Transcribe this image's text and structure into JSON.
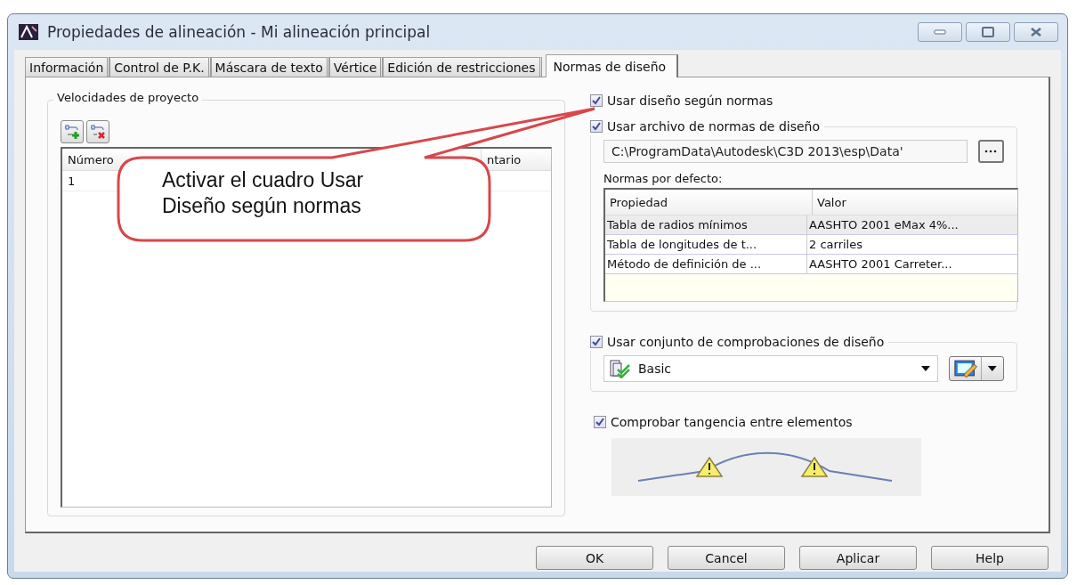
{
  "window": {
    "title": "Propiedades de alineación - Mi alineación principal"
  },
  "tabs": [
    {
      "label": "Información",
      "selected": false
    },
    {
      "label": "Control de P.K.",
      "selected": false
    },
    {
      "label": "Máscara de texto",
      "selected": false
    },
    {
      "label": "Vértice",
      "selected": false
    },
    {
      "label": "Edición de restricciones",
      "selected": false
    },
    {
      "label": "Normas de diseño",
      "selected": true
    }
  ],
  "speeds": {
    "title": "Velocidades de proyecto",
    "columns": [
      "Número",
      "ntario"
    ],
    "rows": [
      [
        "1"
      ]
    ]
  },
  "callout": {
    "text": "Activar el cuadro Usar Diseño según normas"
  },
  "use_design_criteria": {
    "label": "Usar diseño según normas",
    "checked": true
  },
  "criteria_file": {
    "label": "Usar archivo de normas de diseño",
    "checked": true,
    "path": "C:\\ProgramData\\Autodesk\\C3D 2013\\esp\\Data'",
    "defaults_label": "Normas por defecto:",
    "columns": [
      "Propiedad",
      "Valor"
    ],
    "rows": [
      {
        "property": "Tabla de radios mínimos",
        "value": "AASHTO 2001 eMax 4%...",
        "selected": true
      },
      {
        "property": "Tabla de longitudes de t...",
        "value": "2 carriles",
        "selected": false
      },
      {
        "property": "Método de definición de ...",
        "value": "AASHTO 2001 Carreter...",
        "selected": false
      }
    ]
  },
  "check_set": {
    "label": "Usar conjunto de comprobaciones de diseño",
    "checked": true,
    "value": "Basic"
  },
  "tangency": {
    "label": "Comprobar tangencia entre elementos",
    "checked": true
  },
  "buttons": [
    "OK",
    "Cancel",
    "Aplicar",
    "Help"
  ]
}
